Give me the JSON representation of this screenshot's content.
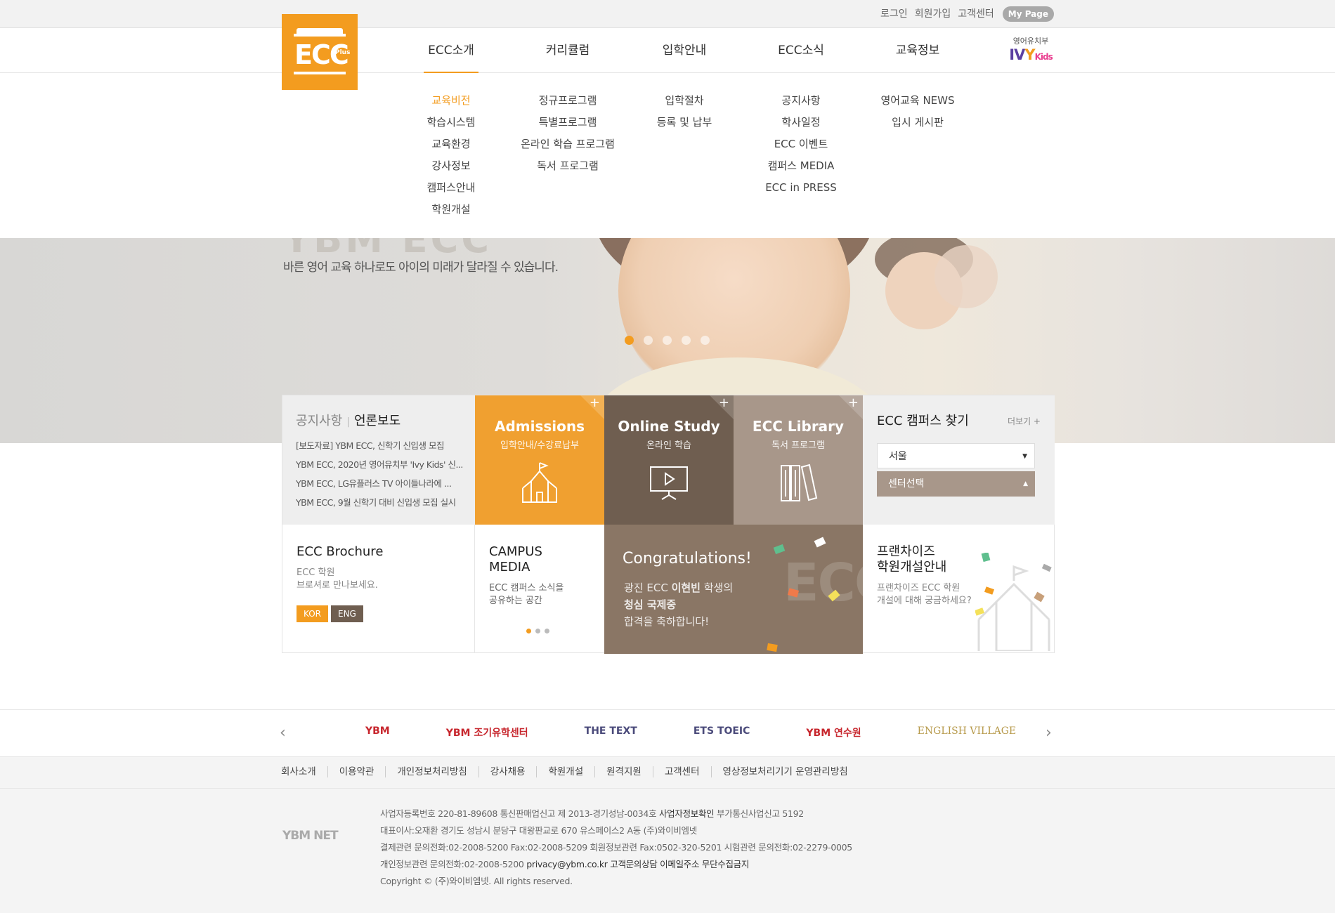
{
  "util_nav": {
    "login": "로그인",
    "signup": "회원가입",
    "support": "고객센터",
    "mypage": "My Page"
  },
  "logo": {
    "word": "ECC",
    "sub": "Plus"
  },
  "gnb": [
    {
      "label": "ECC소개",
      "items": [
        "교육비전",
        "학습시스템",
        "교육환경",
        "강사정보",
        "캠퍼스안내",
        "학원개설"
      ]
    },
    {
      "label": "커리큘럼",
      "items": [
        "정규프로그램",
        "특별프로그램",
        "온라인 학습 프로그램",
        "독서 프로그램"
      ]
    },
    {
      "label": "입학안내",
      "items": [
        "입학절차",
        "등록 및 납부"
      ]
    },
    {
      "label": "ECC소식",
      "items": [
        "공지사항",
        "학사일정",
        "ECC 이벤트",
        "캠퍼스 MEDIA",
        "ECC in PRESS"
      ]
    },
    {
      "label": "교육정보",
      "items": [
        "영어교육 NEWS",
        "입시 게시판"
      ]
    }
  ],
  "ivy": {
    "top": "영어유치부",
    "brand_i": "IV",
    "brand_y": "Y",
    "brand_k": "Kids"
  },
  "hero": {
    "ghost": "YBM ECC",
    "slogan": "바른 영어 교육 하나로도 아이의 미래가 달라질 수 있습니다."
  },
  "notice": {
    "tab_notice": "공지사항",
    "tab_press": "언론보도",
    "items": [
      "[보도자료] YBM ECC, 신학기 신입생 모집",
      "YBM ECC, 2020년 영어유치부 'Ivy Kids' 신...",
      "YBM ECC, LG유플러스 TV 아이들나라에 ...",
      "YBM ECC, 9월 신학기 대비 신입생 모집 실시"
    ]
  },
  "tiles": {
    "admissions": {
      "title": "Admissions",
      "sub": "입학안내/수강료납부"
    },
    "online": {
      "title": "Online Study",
      "sub": "온라인 학습"
    },
    "library": {
      "title": "ECC Library",
      "sub": "독서 프로그램"
    },
    "plus": "+"
  },
  "campus": {
    "title": "ECC 캠퍼스 찾기",
    "more": "더보기 +",
    "region": "서울",
    "center": "센터선택"
  },
  "brochure": {
    "title": "ECC Brochure",
    "desc1": "ECC 학원",
    "desc2": "브로셔로 만나보세요.",
    "kor": "KOR",
    "eng": "ENG"
  },
  "campus_media": {
    "title1": "CAMPUS",
    "title2": "MEDIA",
    "desc1": "ECC 캠퍼스 소식을",
    "desc2": "공유하는 공간"
  },
  "congrats": {
    "title": "Congratulations!",
    "line1_pre": "광진 ECC ",
    "line1_name": "이현빈",
    "line1_post": " 학생의",
    "line2": "청심 국제중",
    "line3": "합격을 축하합니다!",
    "bg": "ECC"
  },
  "franchise": {
    "title1": "프랜차이즈",
    "title2": "학원개설안내",
    "desc1": "프랜차이즈 ECC 학원",
    "desc2": "개설에 대해 궁금하세요?"
  },
  "family_sites": [
    "YBM",
    "YBM 조기유학센터",
    "THE TEXT",
    "ETS TOEIC",
    "YBM 연수원",
    "ENGLISH VILLAGE"
  ],
  "footer_links": [
    "회사소개",
    "이용약관",
    "개인정보처리방침",
    "강사채용",
    "학원개설",
    "원격지원",
    "고객센터",
    "영상정보처리기기 운영관리방침"
  ],
  "footer": {
    "ylogo": "YBM NET",
    "line1_a": "사업자등록번호 220-81-89608 통신판매업신고 제 2013-경기성남-0034호 ",
    "line1_b": "사업자정보확인",
    "line1_c": " 부가통신사업신고 5192",
    "line2": "대표이사:오재환 경기도 성남시 분당구 대왕판교로 670 유스페이스2 A동 (주)와이비엠넷",
    "line3": "결제관련 문의전화:02-2008-5200 Fax:02-2008-5209 회원정보관련 Fax:0502-320-5201 시험관련 문의전화:02-2279-0005",
    "line4_a": "개인정보관련 문의전화:02-2008-5200 ",
    "line4_b": "privacy@ybm.co.kr 고객문의상담 이메일주소 무단수집금지",
    "line5": "Copyright © (주)와이비엠넷. All rights reserved."
  },
  "colors": {
    "accent": "#f39c1f",
    "brown": "#6f5e50",
    "taupe": "#a8978a"
  }
}
